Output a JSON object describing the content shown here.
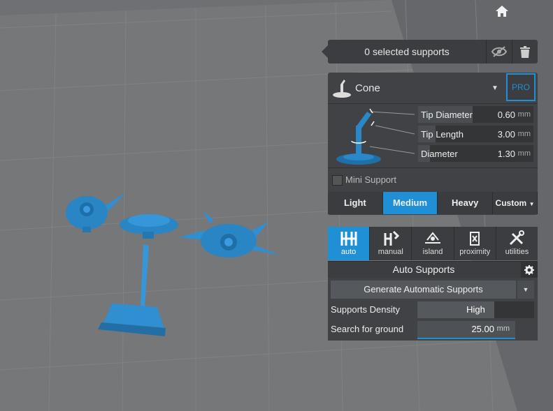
{
  "selection": {
    "text": "0 selected supports"
  },
  "support_type": {
    "label": "Cone",
    "pro_label": "PRO"
  },
  "params": [
    {
      "label": "Tip Diameter",
      "value": "0.60",
      "unit": "mm",
      "fill": 0.47
    },
    {
      "label": "Tip Length",
      "value": "3.00",
      "unit": "mm",
      "fill": 0.15
    },
    {
      "label": "Diameter",
      "value": "1.30",
      "unit": "mm",
      "fill": 0.1
    }
  ],
  "mini_support": {
    "label": "Mini Support",
    "checked": false
  },
  "weights": [
    "Light",
    "Medium",
    "Heavy",
    "Custom"
  ],
  "weight_selected": "Medium",
  "tools": [
    {
      "label": "auto",
      "icon": "auto-supports-icon"
    },
    {
      "label": "manual",
      "icon": "manual-supports-icon"
    },
    {
      "label": "island",
      "icon": "island-icon"
    },
    {
      "label": "proximity",
      "icon": "proximity-icon"
    },
    {
      "label": "utilities",
      "icon": "utilities-icon"
    }
  ],
  "auto": {
    "title": "Auto Supports",
    "generate_label": "Generate Automatic Supports",
    "density_label": "Supports Density",
    "density_value": "High",
    "density_level": 0.66,
    "ground_label": "Search for ground",
    "ground_value": "25.00",
    "ground_unit": "mm"
  },
  "colors": {
    "accent": "#1f8fd6",
    "model": "#2f8fd0",
    "bed": "#75777a",
    "panel": "#404245"
  }
}
